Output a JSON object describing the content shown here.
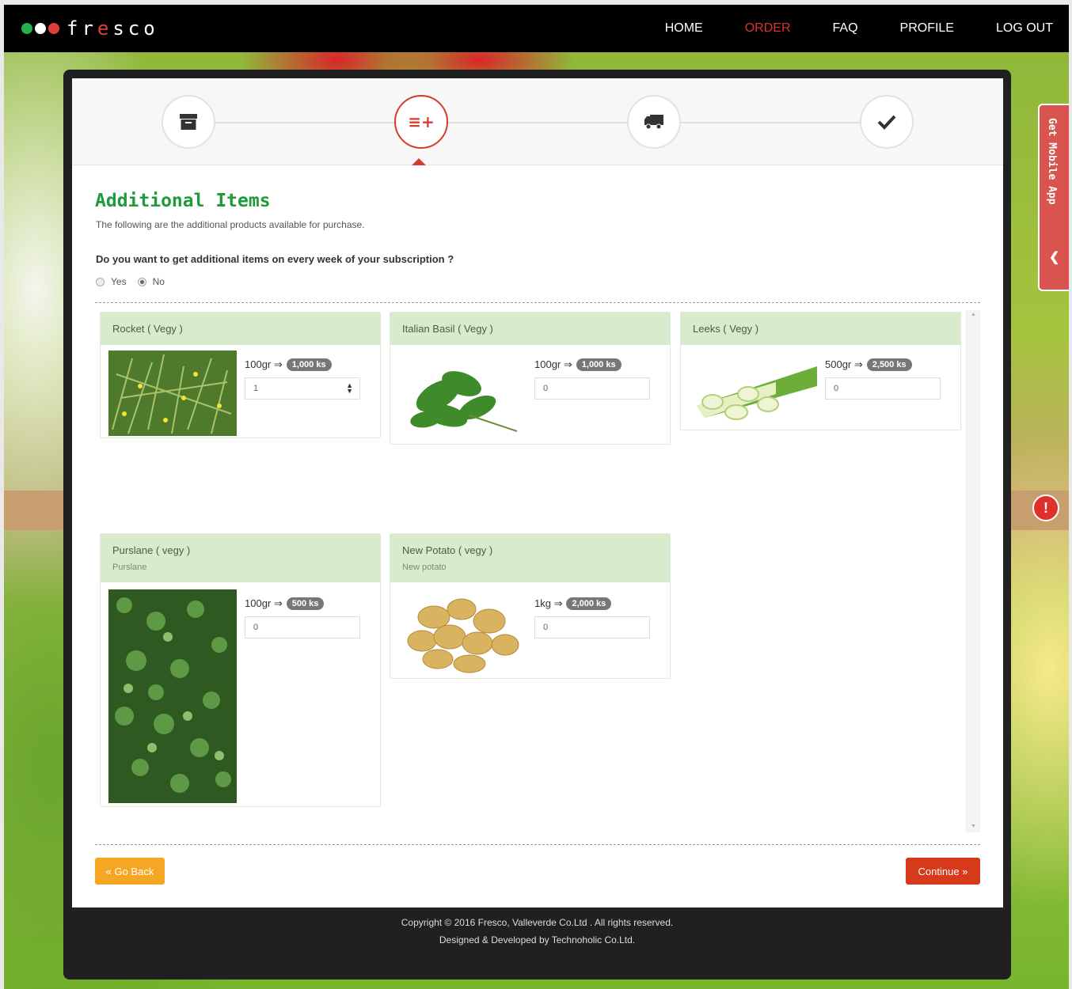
{
  "brand": {
    "name_parts": [
      "fr",
      "e",
      "sco"
    ],
    "dot_colors": [
      "#22b14c",
      "#ffffff",
      "#e23c3c"
    ]
  },
  "nav": {
    "items": [
      "HOME",
      "ORDER",
      "FAQ",
      "PROFILE",
      "LOG OUT"
    ],
    "active": "ORDER"
  },
  "steps": {
    "icons": [
      "archive-icon",
      "list-add-icon",
      "truck-icon",
      "check-icon"
    ],
    "active_index": 1,
    "list_add_glyph": "≡+"
  },
  "page": {
    "title": "Additional Items",
    "subtitle": "The following are the additional products available for purchase.",
    "question": "Do you want to get additional items on every week of your subscription ?",
    "options": [
      "Yes",
      "No"
    ],
    "selected_option": "No"
  },
  "products": [
    {
      "name": "Rocket ( Vegy )",
      "desc": "",
      "unit": "100gr ⇒",
      "price": "1,000 ks",
      "qty": "1",
      "image": "rocket-photo"
    },
    {
      "name": "Italian Basil ( Vegy )",
      "desc": "",
      "unit": "100gr ⇒",
      "price": "1,000 ks",
      "qty": "0",
      "image": "basil-photo"
    },
    {
      "name": "Leeks ( Vegy )",
      "desc": "",
      "unit": "500gr ⇒",
      "price": "2,500 ks",
      "qty": "0",
      "image": "leeks-photo"
    },
    {
      "name": "Purslane ( vegy )",
      "desc": "Purslane",
      "unit": "100gr ⇒",
      "price": "500 ks",
      "qty": "0",
      "image": "purslane-photo"
    },
    {
      "name": "New Potato ( vegy )",
      "desc": "New potato",
      "unit": "1kg ⇒",
      "price": "2,000 ks",
      "qty": "0",
      "image": "potato-photo"
    }
  ],
  "buttons": {
    "back": "« Go Back",
    "continue": "Continue »"
  },
  "footer": {
    "line1": "Copyright © 2016 Fresco, Valleverde Co.Ltd . All rights reserved.",
    "line2": "Designed & Developed by Technoholic Co.Ltd."
  },
  "side": {
    "mobile_app": "Get Mobile App",
    "alert_glyph": "!"
  },
  "colors": {
    "accent_red": "#d63b30",
    "title_green": "#1f9a3c",
    "header_green": "#d8ebcd",
    "back_orange": "#f5a623"
  }
}
